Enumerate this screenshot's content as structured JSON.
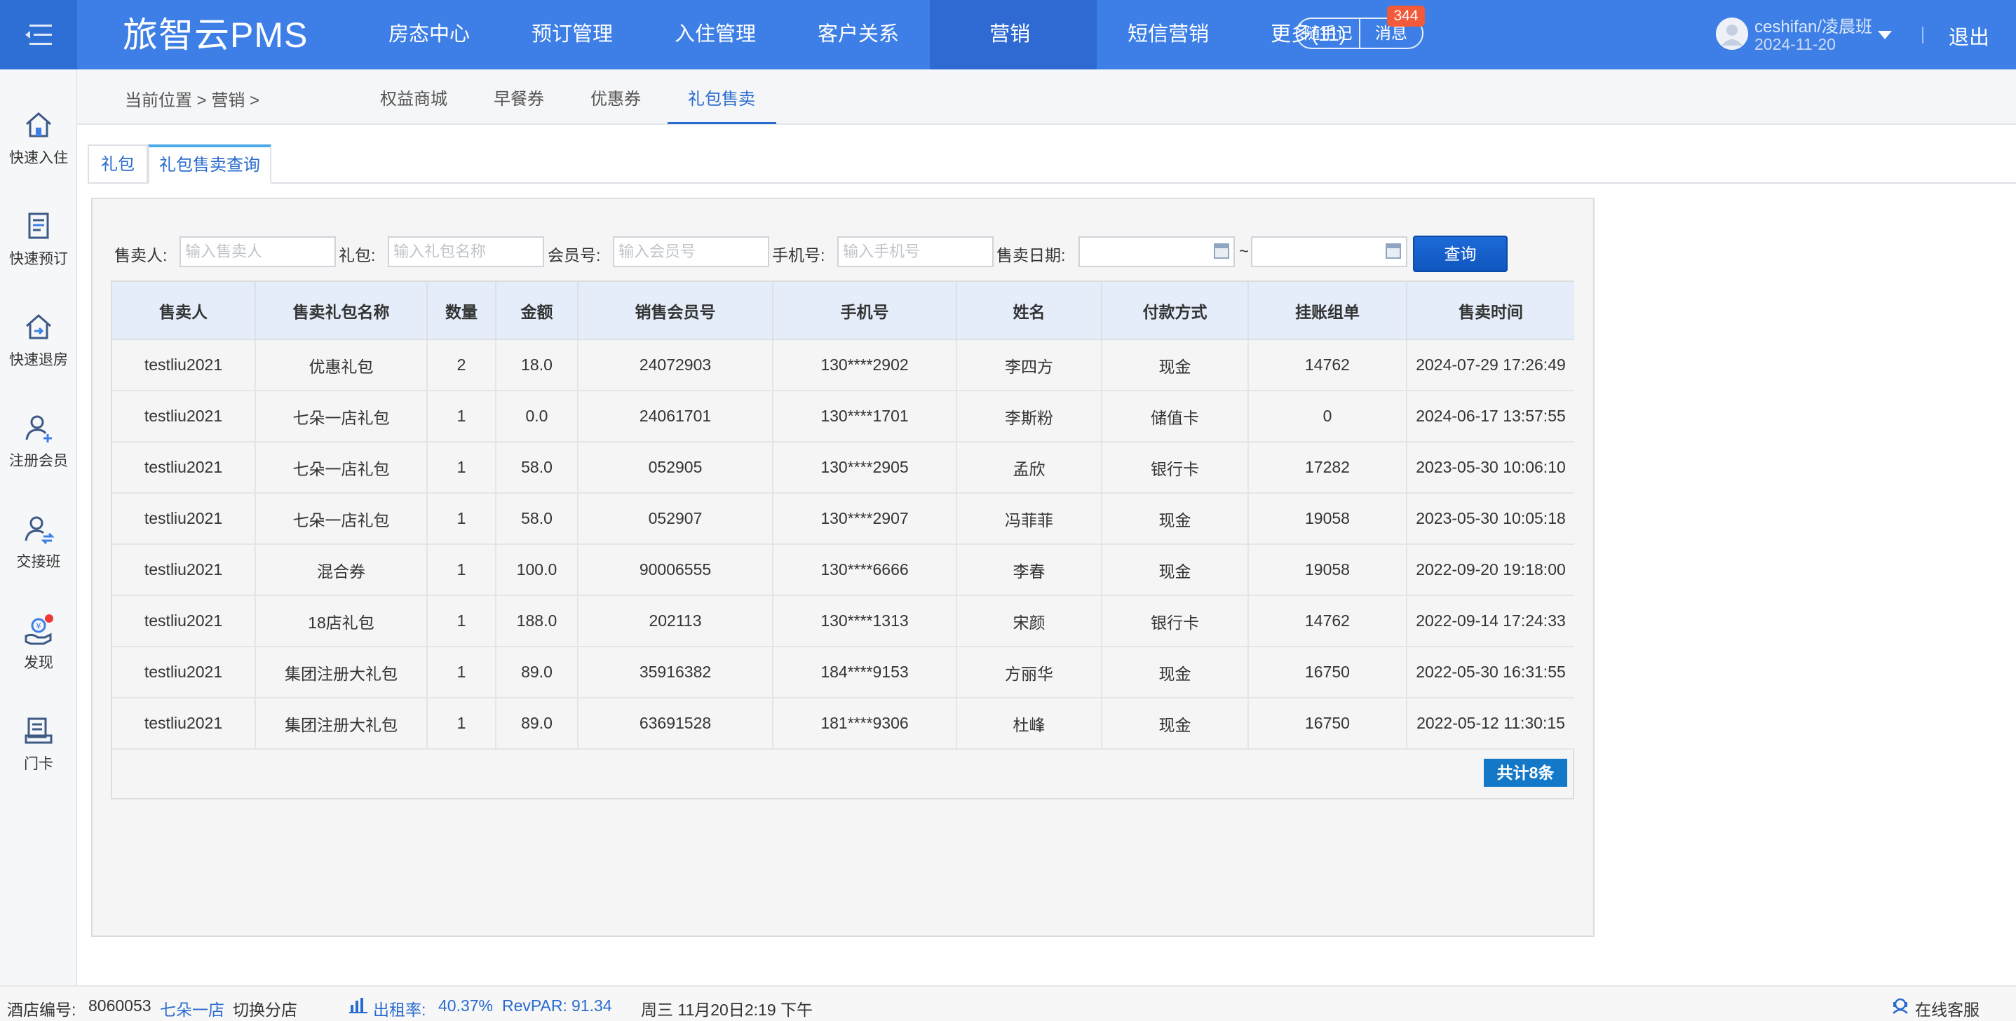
{
  "header": {
    "brand": "旅智云PMS",
    "nav": [
      {
        "label": "房态中心",
        "active": false
      },
      {
        "label": "预订管理",
        "active": false
      },
      {
        "label": "入住管理",
        "active": false
      },
      {
        "label": "客户关系",
        "active": false
      },
      {
        "label": "营销",
        "active": true
      },
      {
        "label": "短信营销",
        "active": false
      },
      {
        "label": "更多(11)",
        "active": false
      }
    ],
    "notes_label": "随手记",
    "messages_label": "消息",
    "messages_badge": "344",
    "user_name": "ceshifan/凌晨班",
    "user_date": "2024-11-20",
    "logout_label": "退出"
  },
  "sidebar": {
    "items": [
      {
        "label": "快速入住",
        "icon": "home-icon"
      },
      {
        "label": "快速预订",
        "icon": "booking-icon"
      },
      {
        "label": "快速退房",
        "icon": "checkout-icon"
      },
      {
        "label": "注册会员",
        "icon": "add-member-icon"
      },
      {
        "label": "交接班",
        "icon": "shift-handover-icon"
      },
      {
        "label": "发现",
        "icon": "discover-icon"
      },
      {
        "label": "门卡",
        "icon": "door-card-icon"
      }
    ]
  },
  "subnav": {
    "breadcrumb": "当前位置 > 营销 >",
    "tabs": [
      {
        "label": "权益商城",
        "active": false
      },
      {
        "label": "早餐券",
        "active": false
      },
      {
        "label": "优惠券",
        "active": false
      },
      {
        "label": "礼包售卖",
        "active": true
      }
    ]
  },
  "content_tabs": [
    {
      "label": "礼包",
      "active": false
    },
    {
      "label": "礼包售卖查询",
      "active": true
    }
  ],
  "filters": {
    "seller_label": "售卖人:",
    "seller_placeholder": "输入售卖人",
    "package_label": "礼包:",
    "package_placeholder": "输入礼包名称",
    "member_label": "会员号:",
    "member_placeholder": "输入会员号",
    "phone_label": "手机号:",
    "phone_placeholder": "输入手机号",
    "date_label": "售卖日期:",
    "date_from": "",
    "date_to": "",
    "date_separator": "~",
    "query_button": "查询"
  },
  "table": {
    "columns": [
      "售卖人",
      "售卖礼包名称",
      "数量",
      "金额",
      "销售会员号",
      "手机号",
      "姓名",
      "付款方式",
      "挂账组单",
      "售卖时间"
    ],
    "rows": [
      [
        "testliu2021",
        "优惠礼包",
        "2",
        "18.0",
        "24072903",
        "130****2902",
        "李四方",
        "现金",
        "14762",
        "2024-07-29 17:26:49"
      ],
      [
        "testliu2021",
        "七朵一店礼包",
        "1",
        "0.0",
        "24061701",
        "130****1701",
        "李斯粉",
        "储值卡",
        "0",
        "2024-06-17 13:57:55"
      ],
      [
        "testliu2021",
        "七朵一店礼包",
        "1",
        "58.0",
        "052905",
        "130****2905",
        "孟欣",
        "银行卡",
        "17282",
        "2023-05-30 10:06:10"
      ],
      [
        "testliu2021",
        "七朵一店礼包",
        "1",
        "58.0",
        "052907",
        "130****2907",
        "冯菲菲",
        "现金",
        "19058",
        "2023-05-30 10:05:18"
      ],
      [
        "testliu2021",
        "混合券",
        "1",
        "100.0",
        "90006555",
        "130****6666",
        "李春",
        "现金",
        "19058",
        "2022-09-20 19:18:00"
      ],
      [
        "testliu2021",
        "18店礼包",
        "1",
        "188.0",
        "202113",
        "130****1313",
        "宋颜",
        "银行卡",
        "14762",
        "2022-09-14 17:24:33"
      ],
      [
        "testliu2021",
        "集团注册大礼包",
        "1",
        "89.0",
        "35916382",
        "184****9153",
        "方丽华",
        "现金",
        "16750",
        "2022-05-30 16:31:55"
      ],
      [
        "testliu2021",
        "集团注册大礼包",
        "1",
        "89.0",
        "63691528",
        "181****9306",
        "杜峰",
        "现金",
        "16750",
        "2022-05-12 11:30:15"
      ]
    ],
    "total_label": "共计8条"
  },
  "footer": {
    "hotel_code_label": "酒店编号:",
    "hotel_code": "8060053",
    "hotel_name": "七朵一店",
    "switch_branch": "切换分店",
    "occupancy_label": "出租率:",
    "occupancy": "40.37%",
    "revpar_label": "RevPAR:",
    "revpar": "91.34",
    "datetime": "周三 11月20日2:19 下午",
    "support": "在线客服"
  },
  "colors": {
    "topbar": "#3d7fe6",
    "topbar_active": "#2e6ad2",
    "accent": "#2a6bcf",
    "badge": "#f25a3a",
    "table_header": "#e4edf9",
    "total_badge": "#1478c8"
  }
}
